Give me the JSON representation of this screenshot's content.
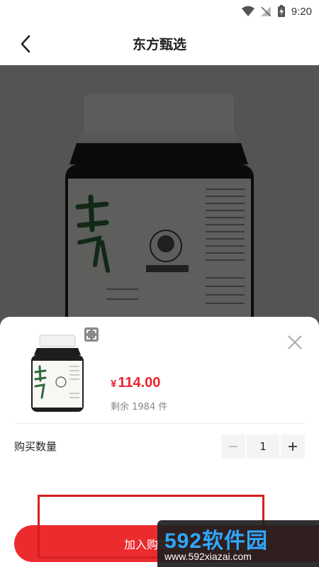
{
  "status_bar": {
    "time": "9:20"
  },
  "header": {
    "title": "东方甄选"
  },
  "sheet": {
    "price_currency": "¥",
    "price_value": "114.00",
    "stock_text": "剩余 1984 件",
    "quantity_label": "购买数量",
    "quantity_value": "1",
    "add_to_cart_label": "加入购物车"
  },
  "watermark": {
    "brand": "592软件园",
    "url": "www.592xiazai.com"
  },
  "colors": {
    "accent": "#ec2b2f",
    "price": "#e8262f",
    "overlay": "rgba(0,0,0,0.62)"
  }
}
